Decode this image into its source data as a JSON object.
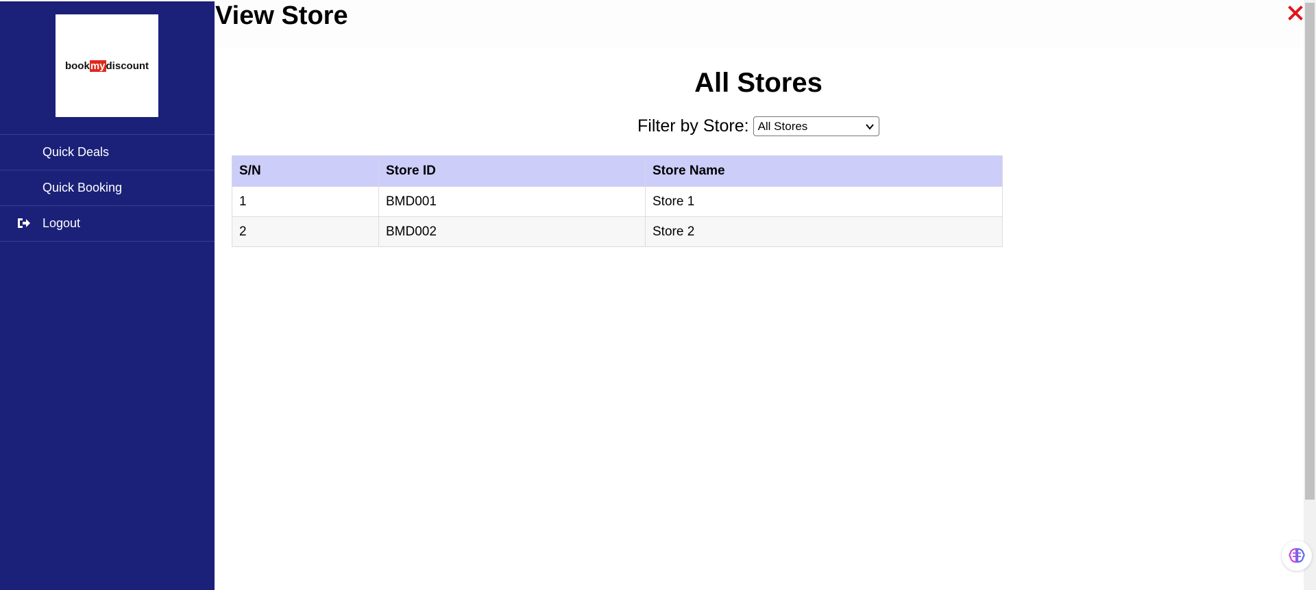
{
  "sidebar": {
    "logo": {
      "part1": "book",
      "part2": "my",
      "part3": "discount"
    },
    "items": [
      {
        "label": "Quick Deals",
        "icon": "none"
      },
      {
        "label": "Quick Booking",
        "icon": "none"
      },
      {
        "label": "Logout",
        "icon": "logout-icon"
      }
    ]
  },
  "header": {
    "title": "View Store",
    "close_icon": "close-icon",
    "close_color": "#e3131b"
  },
  "main": {
    "heading": "All Stores",
    "filter": {
      "label": "Filter by Store:",
      "selected": "All Stores"
    },
    "table": {
      "columns": [
        "S/N",
        "Store ID",
        "Store Name"
      ],
      "rows": [
        [
          "1",
          "BMD001",
          "Store 1"
        ],
        [
          "2",
          "BMD002",
          "Store 2"
        ]
      ]
    }
  },
  "colors": {
    "sidebar_bg": "#1b2078",
    "table_header_bg": "#cccdf9",
    "logo_accent": "#e0281c"
  },
  "floating": {
    "icon": "brain-icon"
  }
}
